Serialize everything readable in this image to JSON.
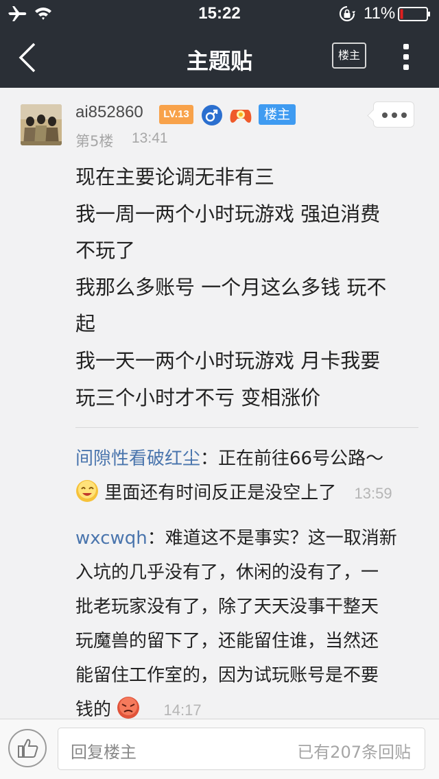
{
  "status_bar": {
    "time": "15:22",
    "battery_percent": "11%",
    "battery_level": 0.11,
    "icons": [
      "airplane-icon",
      "wifi-icon",
      "rotation-lock-icon",
      "battery-icon"
    ]
  },
  "nav": {
    "title": "主题贴",
    "owner_button": "楼主",
    "icons": [
      "back-chevron-icon",
      "more-vertical-icon"
    ]
  },
  "post": {
    "username": "ai852860",
    "level": "LV.13",
    "gender_symbol": "♂",
    "owner_tag": "楼主",
    "floor": "第5楼",
    "time": "13:41",
    "content_lines": [
      "现在主要论调无非有三",
      "我一周一两个小时玩游戏 强迫消费",
      "不玩了",
      "我那么多账号 一个月这么多钱 玩不",
      "起",
      "我一天一两个小时玩游戏 月卡我要",
      "玩三个小时才不亏 变相涨价"
    ]
  },
  "replies": [
    {
      "name": "间隙性看破红尘",
      "line1": "：正在前往66号公路～",
      "line2": "里面还有时间反正是没空上了",
      "time": "13:59",
      "emoji": "smiley-emoji"
    },
    {
      "name": "wxcwqh",
      "line1": "：难道这不是事实？这一取消新",
      "lines": [
        "入坑的几乎没有了，休闲的没有了，一",
        "批老玩家没有了，除了天天没事干整天",
        "玩魔兽的留下了，还能留住谁，当然还",
        "能留住工作室的，因为试玩账号是不要"
      ],
      "last_line": "钱的",
      "time": "14:17",
      "emoji": "angry-emoji"
    }
  ],
  "bottom": {
    "reply_placeholder": "回复楼主",
    "reply_count": "已有207条回贴"
  },
  "colors": {
    "nav_bg": "#2a2f36",
    "level_badge": "#f8a24a",
    "owner_tag": "#3f9bf1",
    "reply_name": "#4a75ad",
    "gender": "#2b6fcf"
  }
}
